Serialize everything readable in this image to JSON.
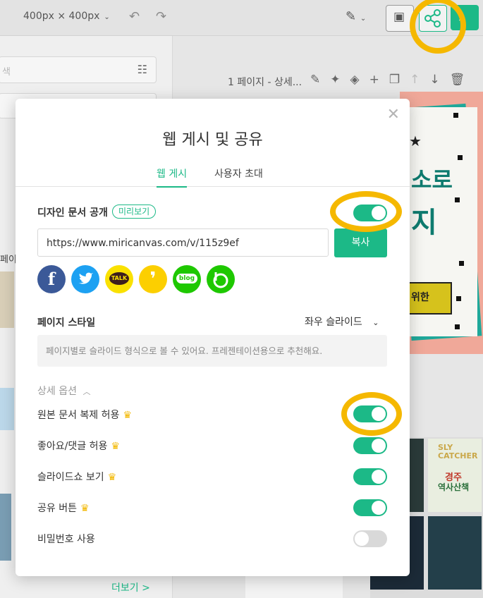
{
  "topbar": {
    "size": "400px × 400px"
  },
  "left_panel": {
    "search_placeholder": "색",
    "text_pei": "페이",
    "more_label": "더보기 >"
  },
  "canvas": {
    "page_label": "1 페이지 - 상세...",
    "art_text_1": "소로",
    "art_text_2": "지",
    "art_button": "위한"
  },
  "thumbnails": {
    "t1_a": "SLY",
    "t1_b": "CATCHER",
    "t2_a": "경주",
    "t2_b": "역사산책"
  },
  "modal": {
    "title": "웹 게시 및 공유",
    "tabs": [
      "웹 게시",
      "사용자 초대"
    ],
    "publish_label": "디자인 문서 공개",
    "preview_badge": "미리보기",
    "url": "https://www.miricanvas.com/v/115z9ef",
    "copy_label": "복사",
    "share_icons": [
      "facebook-icon",
      "twitter-icon",
      "kakaotalk-icon",
      "kakaostory-icon",
      "naver-blog-icon",
      "band-icon"
    ],
    "page_style_label": "페이지 스타일",
    "page_style_value": "좌우 슬라이드",
    "page_style_desc": "페이지별로 슬라이드 형식으로 볼 수 있어요. 프레젠테이션용으로 추천해요.",
    "details_label": "상세 옵션",
    "options": [
      {
        "label": "원본 문서 복제 허용",
        "premium": true,
        "on": true
      },
      {
        "label": "좋아요/댓글 허용",
        "premium": true,
        "on": true
      },
      {
        "label": "슬라이드쇼 보기",
        "premium": true,
        "on": true
      },
      {
        "label": "공유 버튼",
        "premium": true,
        "on": true
      },
      {
        "label": "비밀번호 사용",
        "premium": false,
        "on": false
      }
    ]
  },
  "colors": {
    "accent": "#1cb987",
    "highlight": "#f5b800"
  }
}
